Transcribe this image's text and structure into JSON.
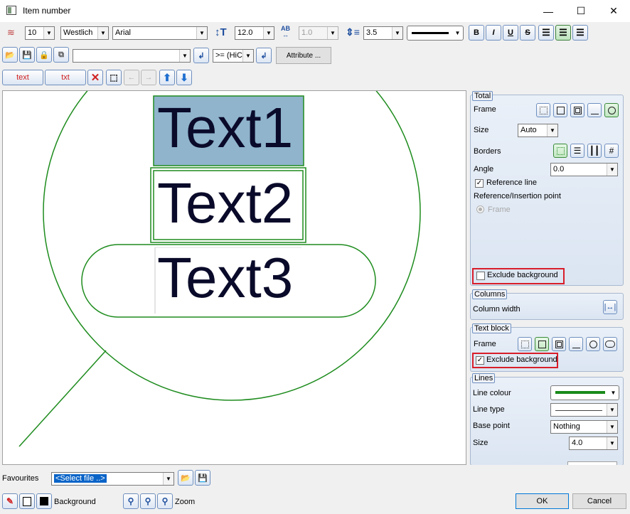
{
  "window": {
    "title": "Item number",
    "minimize": "—",
    "maximize": "☐",
    "close": "✕"
  },
  "toolbar1": {
    "layer_value": "10",
    "font_style_value": "Westlich",
    "font_value": "Arial",
    "height_value": "12.0",
    "ratio_value": "1.0",
    "spacing_value": "3.5",
    "bold_label": "B",
    "italic_label": "I",
    "underline_label": "U",
    "strike_label": "S"
  },
  "toolbar2": {
    "attribute_select_value": "",
    "condition_value": ">= (HiC",
    "attribute_button_label": "Attribute ..."
  },
  "toolbar3": {
    "text_button_label": "text",
    "txt_button_label": "txt"
  },
  "canvas": {
    "text1": "Text1",
    "text2": "Text2",
    "text3": "Text3"
  },
  "panel": {
    "total": {
      "title": "Total",
      "frame_label": "Frame",
      "size_label": "Size",
      "size_value": "Auto",
      "borders_label": "Borders",
      "angle_label": "Angle",
      "angle_value": "0.0",
      "reference_line_label": "Reference line",
      "reference_line_checked": true,
      "reference_point_label": "Reference/Insertion point",
      "frame_radio_label": "Frame",
      "exclude_background_label": "Exclude background",
      "exclude_background_checked": false
    },
    "columns": {
      "title": "Columns",
      "column_width_label": "Column width"
    },
    "text_block": {
      "title": "Text block",
      "frame_label": "Frame",
      "exclude_background_label": "Exclude background",
      "exclude_background_checked": true
    },
    "lines": {
      "title": "Lines",
      "line_colour_label": "Line colour",
      "line_colour": "#1a8a1a",
      "line_type_label": "Line type",
      "base_point_label": "Base point",
      "base_point_value": "Nothing",
      "size_label": "Size",
      "size_value": "4.0"
    }
  },
  "favourites": {
    "label": "Favourites",
    "select_value": "<Select file ..>"
  },
  "bottom": {
    "background_label": "Background",
    "zoom_label": "Zoom",
    "ok_label": "OK",
    "cancel_label": "Cancel"
  },
  "colors": {
    "frame_green": "#1e8c1e",
    "text1_fill": "#8fb4cc",
    "highlight_red": "#d81e2a"
  }
}
